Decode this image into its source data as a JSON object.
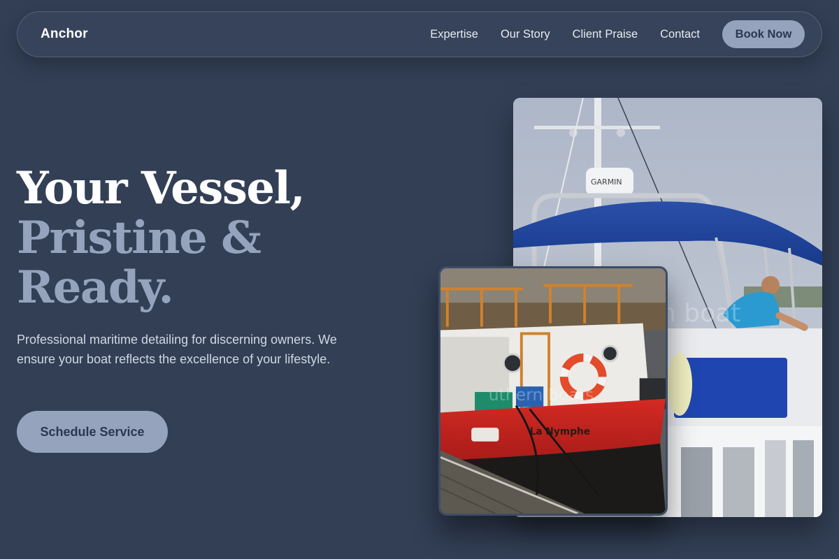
{
  "nav": {
    "brand": "Anchor",
    "links": [
      "Expertise",
      "Our Story",
      "Client Praise",
      "Contact"
    ],
    "cta_label": "Book Now"
  },
  "hero": {
    "title_line1": "Your Vessel,",
    "title_line2": "Pristine &",
    "title_line3": "Ready.",
    "description": "Professional maritime detailing for discerning owners. We ensure your boat reflects the excellence of your lifestyle.",
    "cta_label": "Schedule Service"
  },
  "photos": {
    "large": {
      "radar_brand": "GARMIN",
      "watermark": "n boat"
    },
    "small": {
      "boat_name": "La Nymphe",
      "watermark": "uthern boats"
    }
  },
  "colors": {
    "background": "#323f55",
    "accent": "#95a3bd",
    "accent_text": "#2b3850",
    "heading": "#ffffff",
    "body_text": "#d1d8e4"
  }
}
